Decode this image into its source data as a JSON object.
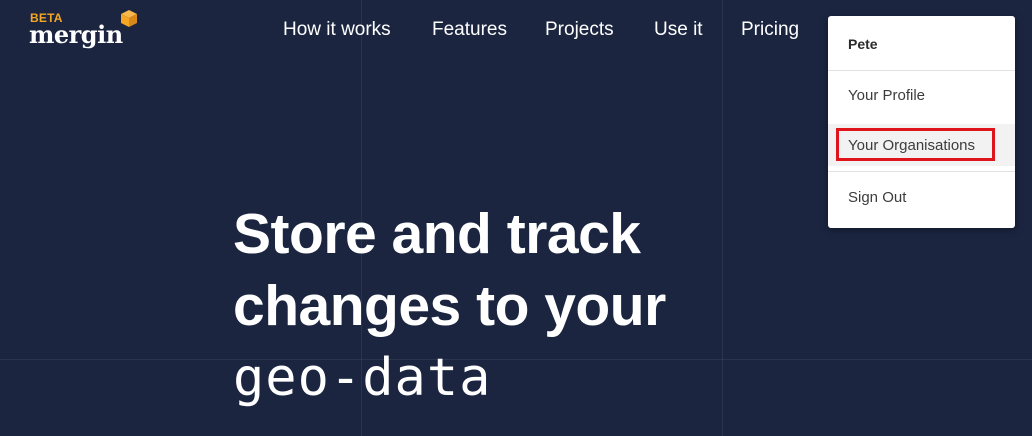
{
  "brand": {
    "beta_label": "BETA",
    "name": "mergin",
    "accent_color": "#f5a623",
    "background_color": "#1b2540"
  },
  "nav": {
    "items": [
      "How it works",
      "Features",
      "Projects",
      "Use it",
      "Pricing"
    ]
  },
  "hero": {
    "line1": "Store and track",
    "line2": "changes to your",
    "line3": "geo-data"
  },
  "user_menu": {
    "username": "Pete",
    "items": [
      "Your Profile",
      "Your Organisations",
      "Sign Out"
    ],
    "highlighted_item": "Your Organisations",
    "highlight_color": "#e0141b"
  }
}
